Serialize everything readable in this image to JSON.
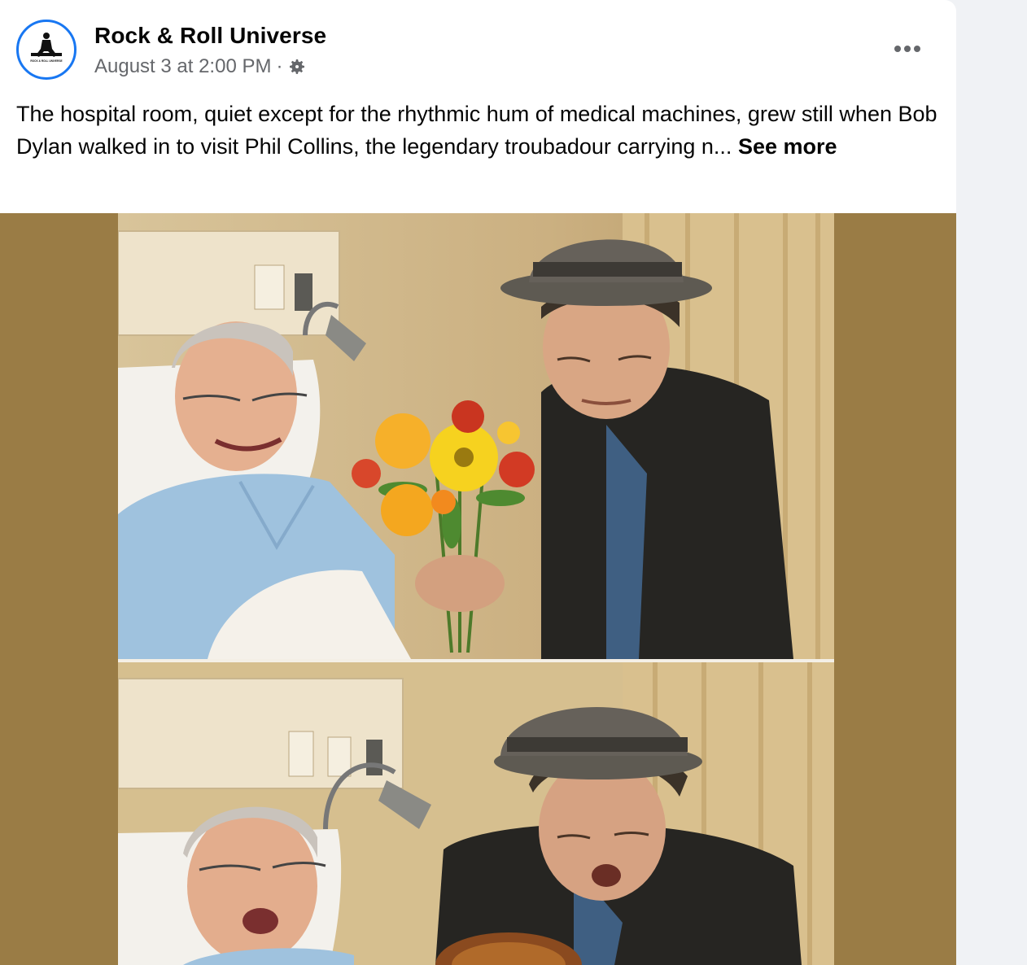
{
  "post": {
    "page_name": "Rock & Roll Universe",
    "timestamp": "August 3 at 2:00 PM",
    "separator": "·",
    "avatar_text": "ROCK & ROLL UNIVERSE",
    "text": "The hospital room, quiet except for the rhythmic hum of medical machines, grew still when Bob Dylan walked in to visit Phil Collins, the legendary troubadour carrying n...",
    "see_more_label": "See more"
  },
  "icons": {
    "audience": "gear-icon",
    "more": "more-options-icon"
  },
  "colors": {
    "accent": "#1877f2",
    "media_background": "#9a7c45",
    "secondary_text": "#65676b"
  }
}
